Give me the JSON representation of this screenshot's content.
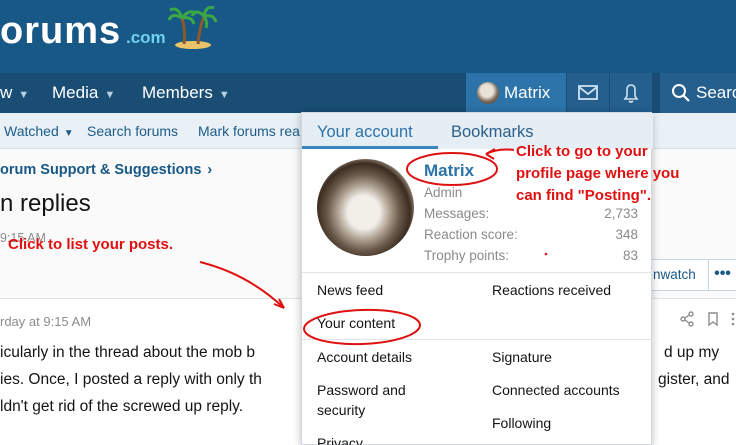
{
  "brand": {
    "text": "orums",
    "tld": ".com"
  },
  "nav": {
    "items": [
      {
        "label": "w"
      },
      {
        "label": "Media"
      },
      {
        "label": "Members"
      }
    ],
    "user_label": "Matrix",
    "search_label": "Searc"
  },
  "subnav": {
    "items": [
      "Watched",
      "Search forums",
      "Mark forums rea"
    ]
  },
  "breadcrumb": "orum Support & Suggestions",
  "thread": {
    "title": "n replies",
    "time": "9:15 AM"
  },
  "watch_label": "nwatch",
  "more_label": "•••",
  "post": {
    "date": "rday at 9:15 AM",
    "lines": [
      "icularly in the thread about the mob b",
      "ies. Once, I posted a reply with only th",
      "ldn't get rid of the screwed up reply."
    ],
    "right_lines": [
      "d up my",
      "gister, and"
    ]
  },
  "account_menu": {
    "tabs": [
      "Your account",
      "Bookmarks"
    ],
    "name": "Matrix",
    "role": "Admin",
    "stats": [
      {
        "label": "Messages:",
        "value": "2,733"
      },
      {
        "label": "Reaction score:",
        "value": "348"
      },
      {
        "label": "Trophy points:",
        "value": "83"
      }
    ],
    "left_links": [
      "News feed",
      "Your content",
      "Account details",
      "Password and",
      "security",
      "Privacy"
    ],
    "right_links": [
      "Reactions received",
      "Signature",
      "Connected accounts",
      "Following"
    ]
  },
  "annotations": {
    "profile_lines": [
      "Click to go to your",
      "profile page where you",
      "can find \"Posting\"."
    ],
    "posts_line": "Click to list your posts."
  }
}
